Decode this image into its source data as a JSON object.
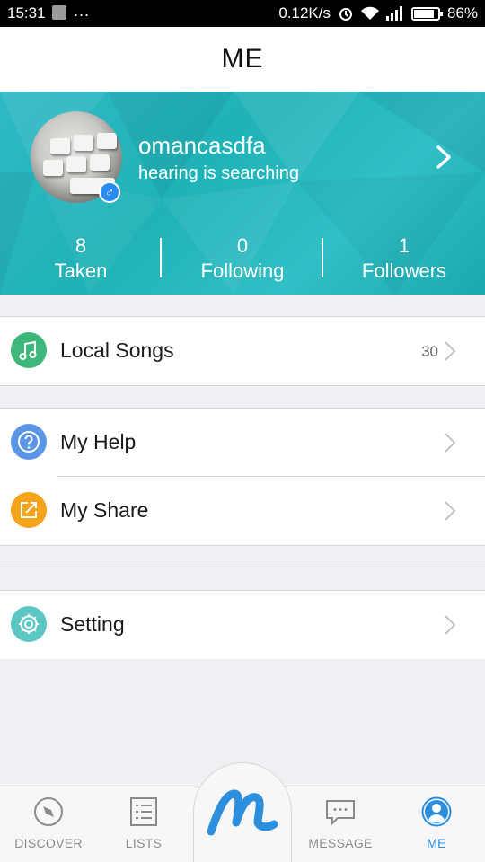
{
  "status_bar": {
    "time": "15:31",
    "notification_dots": "...",
    "network_speed": "0.12K/s",
    "battery_percent": "86%",
    "battery_level": 0.86
  },
  "header": {
    "title": "ME"
  },
  "profile": {
    "username": "omancasdfa",
    "signature": "hearing is searching",
    "gender_symbol": "♂",
    "stats": [
      {
        "value": "8",
        "label": "Taken"
      },
      {
        "value": "0",
        "label": "Following"
      },
      {
        "value": "1",
        "label": "Followers"
      }
    ]
  },
  "menu": {
    "local_songs": {
      "label": "Local Songs",
      "count": "30",
      "icon": "music-note-icon",
      "color": "#3db87a"
    },
    "my_help": {
      "label": "My Help",
      "icon": "question-icon",
      "color": "#5b95e6"
    },
    "my_share": {
      "label": "My Share",
      "icon": "share-icon",
      "color": "#f5a31a"
    },
    "setting": {
      "label": "Setting",
      "icon": "gear-icon",
      "color": "#5cc6c4"
    }
  },
  "bottom_nav": {
    "discover": "DISCOVER",
    "lists": "LISTS",
    "message": "MESSAGE",
    "me": "ME",
    "active": "ME",
    "active_color": "#2b8fde",
    "inactive_color": "#8b8b8b"
  }
}
